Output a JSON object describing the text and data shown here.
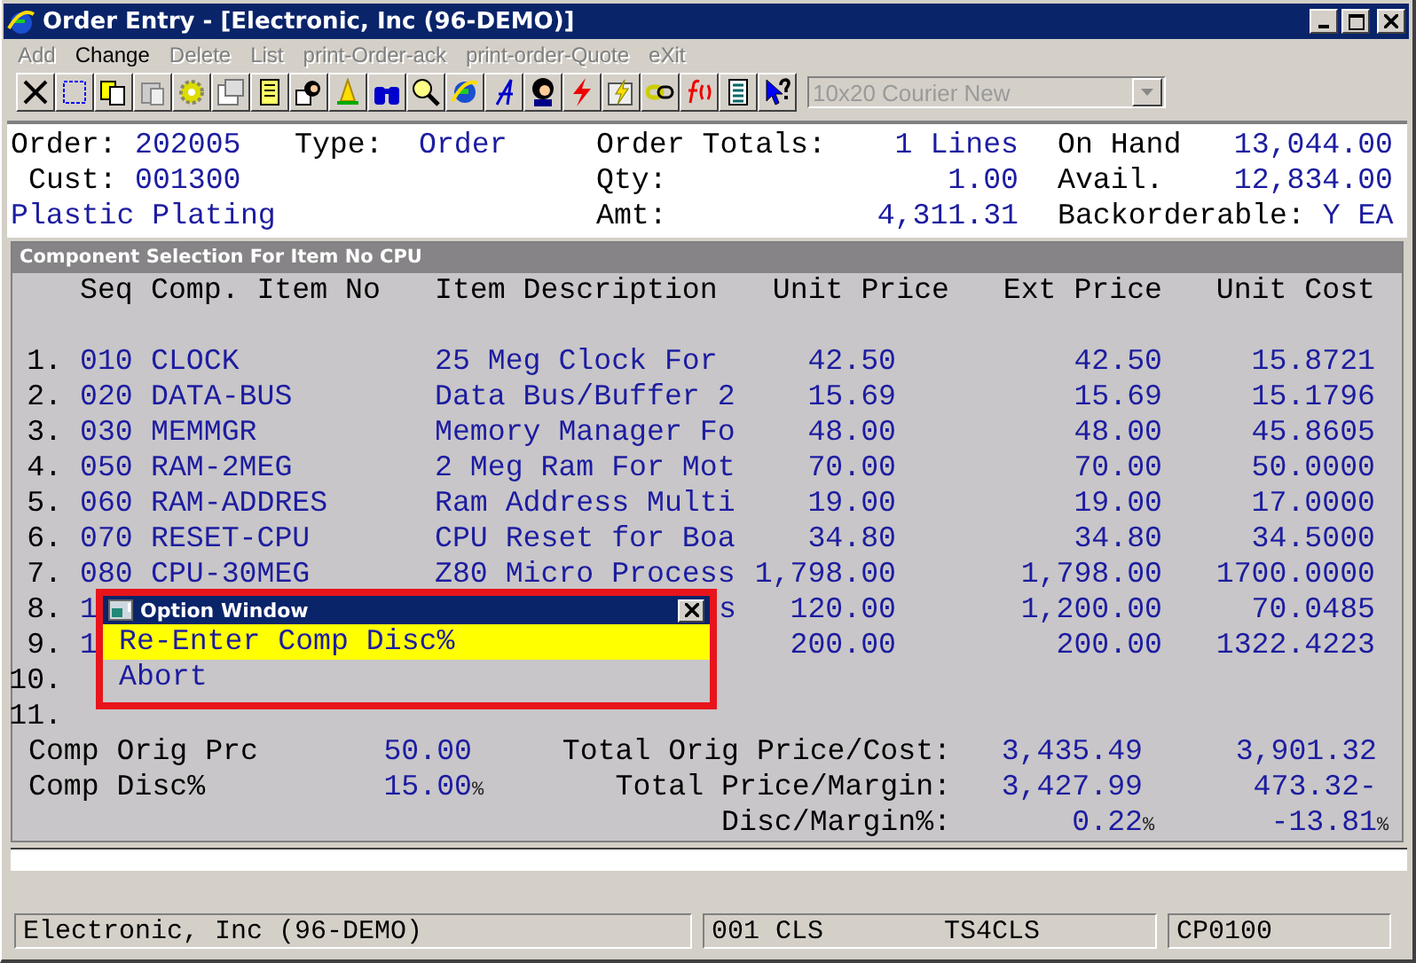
{
  "window": {
    "title": "Order Entry - [Electronic, Inc (96-DEMO)]"
  },
  "menu": [
    {
      "label": "Add",
      "disabled": true
    },
    {
      "label": "Change",
      "disabled": false
    },
    {
      "label": "Delete",
      "disabled": true
    },
    {
      "label": "List",
      "disabled": true
    },
    {
      "label": "print-Order-ack",
      "disabled": true
    },
    {
      "label": "print-order-Quote",
      "disabled": true
    },
    {
      "label": "eXit",
      "disabled": true
    }
  ],
  "toolbar": {
    "font_combo": {
      "value": "10x20 Courier New",
      "disabled": true
    }
  },
  "header": {
    "rows": [
      {
        "cells": [
          {
            "kind": "label",
            "text": "Order:"
          },
          {
            "kind": "value",
            "text": "202005"
          },
          {
            "kind": "label",
            "text": "Type:"
          },
          {
            "kind": "value",
            "text": "Order"
          },
          {
            "kind": "label",
            "text": "Order Totals:"
          },
          {
            "kind": "value",
            "text": "1 Lines"
          },
          {
            "kind": "label",
            "text": "On Hand"
          },
          {
            "kind": "value",
            "text": "13,044.00"
          }
        ]
      },
      {
        "cells": [
          {
            "kind": "label",
            "text": "Cust:"
          },
          {
            "kind": "value",
            "text": "001300"
          },
          {
            "kind": "blank"
          },
          {
            "kind": "blank"
          },
          {
            "kind": "label",
            "text": "Qty:"
          },
          {
            "kind": "value",
            "text": "1.00"
          },
          {
            "kind": "label",
            "text": "Avail."
          },
          {
            "kind": "value",
            "text": "12,834.00"
          }
        ]
      },
      {
        "cells": [
          {
            "kind": "wide",
            "text": "Plastic Plating"
          },
          {
            "kind": "blank"
          },
          {
            "kind": "blank"
          },
          {
            "kind": "blank"
          },
          {
            "kind": "label",
            "text": "Amt:"
          },
          {
            "kind": "value",
            "text": "4,311.31"
          },
          {
            "kind": "pair",
            "text": "Backorderable:",
            "value": "Y EA"
          }
        ]
      }
    ]
  },
  "panel": {
    "title": "Component Selection For Item No CPU",
    "columns": [
      "Seq",
      "Comp. Item No",
      "Item Description",
      "Unit Price",
      "Ext Price",
      "Unit Cost"
    ],
    "rows": [
      {
        "kind": "full",
        "num": "1.",
        "seq": "010",
        "item": "CLOCK",
        "desc": "25 Meg Clock For",
        "unit_price": "42.50",
        "ext_price": "42.50",
        "unit_cost": "15.8721"
      },
      {
        "kind": "full",
        "num": "2.",
        "seq": "020",
        "item": "DATA-BUS",
        "desc": "Data Bus/Buffer 2",
        "unit_price": "15.69",
        "ext_price": "15.69",
        "unit_cost": "15.1796"
      },
      {
        "kind": "full",
        "num": "3.",
        "seq": "030",
        "item": "MEMMGR",
        "desc": "Memory Manager Fo",
        "unit_price": "48.00",
        "ext_price": "48.00",
        "unit_cost": "45.8605"
      },
      {
        "kind": "full",
        "num": "4.",
        "seq": "050",
        "item": "RAM-2MEG",
        "desc": "2 Meg Ram For Mot",
        "unit_price": "70.00",
        "ext_price": "70.00",
        "unit_cost": "50.0000"
      },
      {
        "kind": "full",
        "num": "5.",
        "seq": "060",
        "item": "RAM-ADDRES",
        "desc": "Ram Address Multi",
        "unit_price": "19.00",
        "ext_price": "19.00",
        "unit_cost": "17.0000"
      },
      {
        "kind": "full",
        "num": "6.",
        "seq": "070",
        "item": "RESET-CPU",
        "desc": "CPU Reset for Boa",
        "unit_price": "34.80",
        "ext_price": "34.80",
        "unit_cost": "34.5000"
      },
      {
        "kind": "full",
        "num": "7.",
        "seq": "080",
        "item": "CPU-30MEG",
        "desc": "Z80 Micro Process",
        "unit_price": "1,798.00",
        "ext_price": "1,798.00",
        "unit_cost": "1700.0000"
      },
      {
        "kind": "partial",
        "num": "8.",
        "seq": "1",
        "desc": "s",
        "unit_price": "120.00",
        "ext_price": "1,200.00",
        "unit_cost": "70.0485"
      },
      {
        "kind": "partial",
        "num": "9.",
        "seq": "1",
        "unit_price": "200.00",
        "ext_price": "200.00",
        "unit_cost": "1322.4223"
      },
      {
        "kind": "full",
        "num": "10."
      },
      {
        "kind": "full",
        "num": "11."
      }
    ],
    "summary": [
      {
        "label": "Comp Orig Prc",
        "value": "50.00",
        "total_label": "Total Orig Price/Cost:",
        "total": "3,435.49",
        "cost": "3,901.32"
      },
      {
        "label": "Comp Disc%",
        "value": "15.00",
        "value_unit": "%",
        "total_label": "Total Price/Margin:",
        "total": "3,427.99",
        "cost": "473.32-"
      },
      {
        "total_label": "Disc/Margin%:",
        "total": "0.22",
        "total_unit": "%",
        "cost": "-13.81",
        "cost_unit": "%"
      }
    ]
  },
  "option_window": {
    "title": "Option Window",
    "items": [
      {
        "label": "Re-Enter Comp Disc%",
        "selected": true
      },
      {
        "label": "Abort",
        "selected": false
      }
    ]
  },
  "status_bar": {
    "company": "Electronic, Inc (96-DEMO)",
    "user": "001 CLS",
    "station": "TS4CLS",
    "program": "CP0100"
  }
}
